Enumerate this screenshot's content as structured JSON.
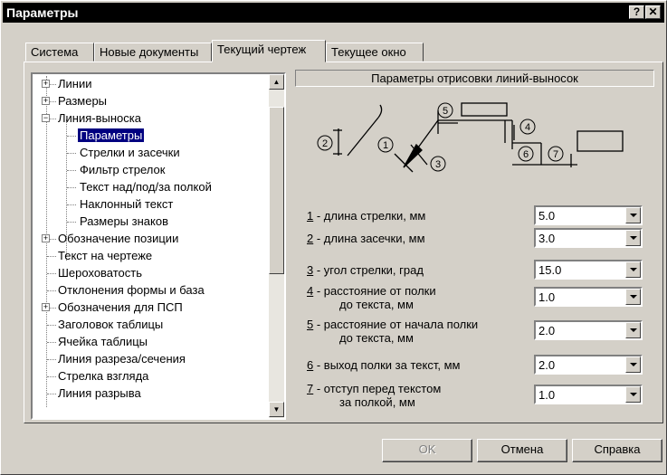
{
  "window": {
    "title": "Параметры",
    "help_btn": "?",
    "close_btn": "✕"
  },
  "tabs": [
    {
      "label": "Система",
      "active": false
    },
    {
      "label": "Новые документы",
      "active": false
    },
    {
      "label": "Текущий чертеж",
      "active": true
    },
    {
      "label": "Текущее окно",
      "active": false
    }
  ],
  "tree": {
    "items": [
      {
        "label": "Линии",
        "expander": "+"
      },
      {
        "label": "Размеры",
        "expander": "+"
      },
      {
        "label": "Линия-выноска",
        "expander": "−"
      },
      {
        "label": "Параметры",
        "selected": true
      },
      {
        "label": "Стрелки и засечки"
      },
      {
        "label": "Фильтр стрелок"
      },
      {
        "label": "Текст над/под/за полкой"
      },
      {
        "label": "Наклонный текст"
      },
      {
        "label": "Размеры знаков"
      },
      {
        "label": "Обозначение позиции",
        "expander": "+"
      },
      {
        "label": "Текст на чертеже"
      },
      {
        "label": "Шероховатость"
      },
      {
        "label": "Отклонения формы и база"
      },
      {
        "label": "Обозначения для ПСП",
        "expander": "+"
      },
      {
        "label": "Заголовок таблицы"
      },
      {
        "label": "Ячейка таблицы"
      },
      {
        "label": "Линия разреза/сечения"
      },
      {
        "label": "Стрелка взгляда"
      },
      {
        "label": "Линия разрыва"
      }
    ]
  },
  "section_header": "Параметры отрисовки линий-выносок",
  "diagram_labels": [
    "1",
    "2",
    "3",
    "4",
    "5",
    "6",
    "7"
  ],
  "params": [
    {
      "num": "1",
      "line1": " - длина стрелки, мм",
      "line2": "",
      "value": "5.0"
    },
    {
      "num": "2",
      "line1": " - длина засечки, мм",
      "line2": "",
      "value": "3.0"
    },
    {
      "num": "3",
      "line1": " - угол стрелки, град",
      "line2": "",
      "value": "15.0"
    },
    {
      "num": "4",
      "line1": " - расстояние от полки",
      "line2": "до текста, мм",
      "value": "1.0"
    },
    {
      "num": "5",
      "line1": " - расстояние от начала полки",
      "line2": "до текста, мм",
      "value": "2.0"
    },
    {
      "num": "6",
      "line1": " - выход полки за текст, мм",
      "line2": "",
      "value": "2.0"
    },
    {
      "num": "7",
      "line1": " - отступ перед текстом",
      "line2": "за полкой, мм",
      "value": "1.0"
    }
  ],
  "buttons": {
    "ok": "OK",
    "cancel": "Отмена",
    "help": "Справка"
  }
}
